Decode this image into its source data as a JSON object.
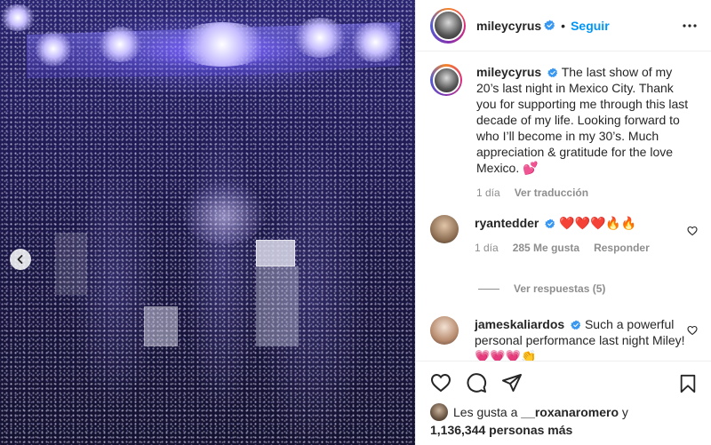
{
  "post": {
    "username": "mileycyrus",
    "follow_label": "Seguir",
    "dot": "•"
  },
  "caption": {
    "username": "mileycyrus",
    "text": "The last show of my 20’s last night in Mexico City. Thank you for supporting me through this last decade of my life. Looking forward to who I’ll become in my 30’s. Much appreciation & gratitude for the love Mexico. 💕",
    "time": "1 día",
    "translate_label": "Ver traducción"
  },
  "comments": [
    {
      "username": "ryantedder",
      "text": "❤️❤️❤️🔥🔥",
      "time": "1 día",
      "likes": "285 Me gusta",
      "reply_label": "Responder"
    },
    {
      "username": "jameskaliardos",
      "text": "Such a powerful personal performance last night Miley! 💗💗💗👏"
    }
  ],
  "replies_label": "Ver respuestas (5)",
  "likes": {
    "prefix": "Les gusta a",
    "user": "__roxanaromero",
    "suffix": "y",
    "count": "1,136,344 personas más"
  },
  "colors": {
    "accent": "#0095f6",
    "verified": "#3897f0",
    "muted": "#8e8e8e"
  },
  "icons": [
    "verified-icon",
    "more-icon",
    "heart-icon",
    "comment-icon",
    "share-icon",
    "bookmark-icon",
    "chevron-left-icon"
  ]
}
